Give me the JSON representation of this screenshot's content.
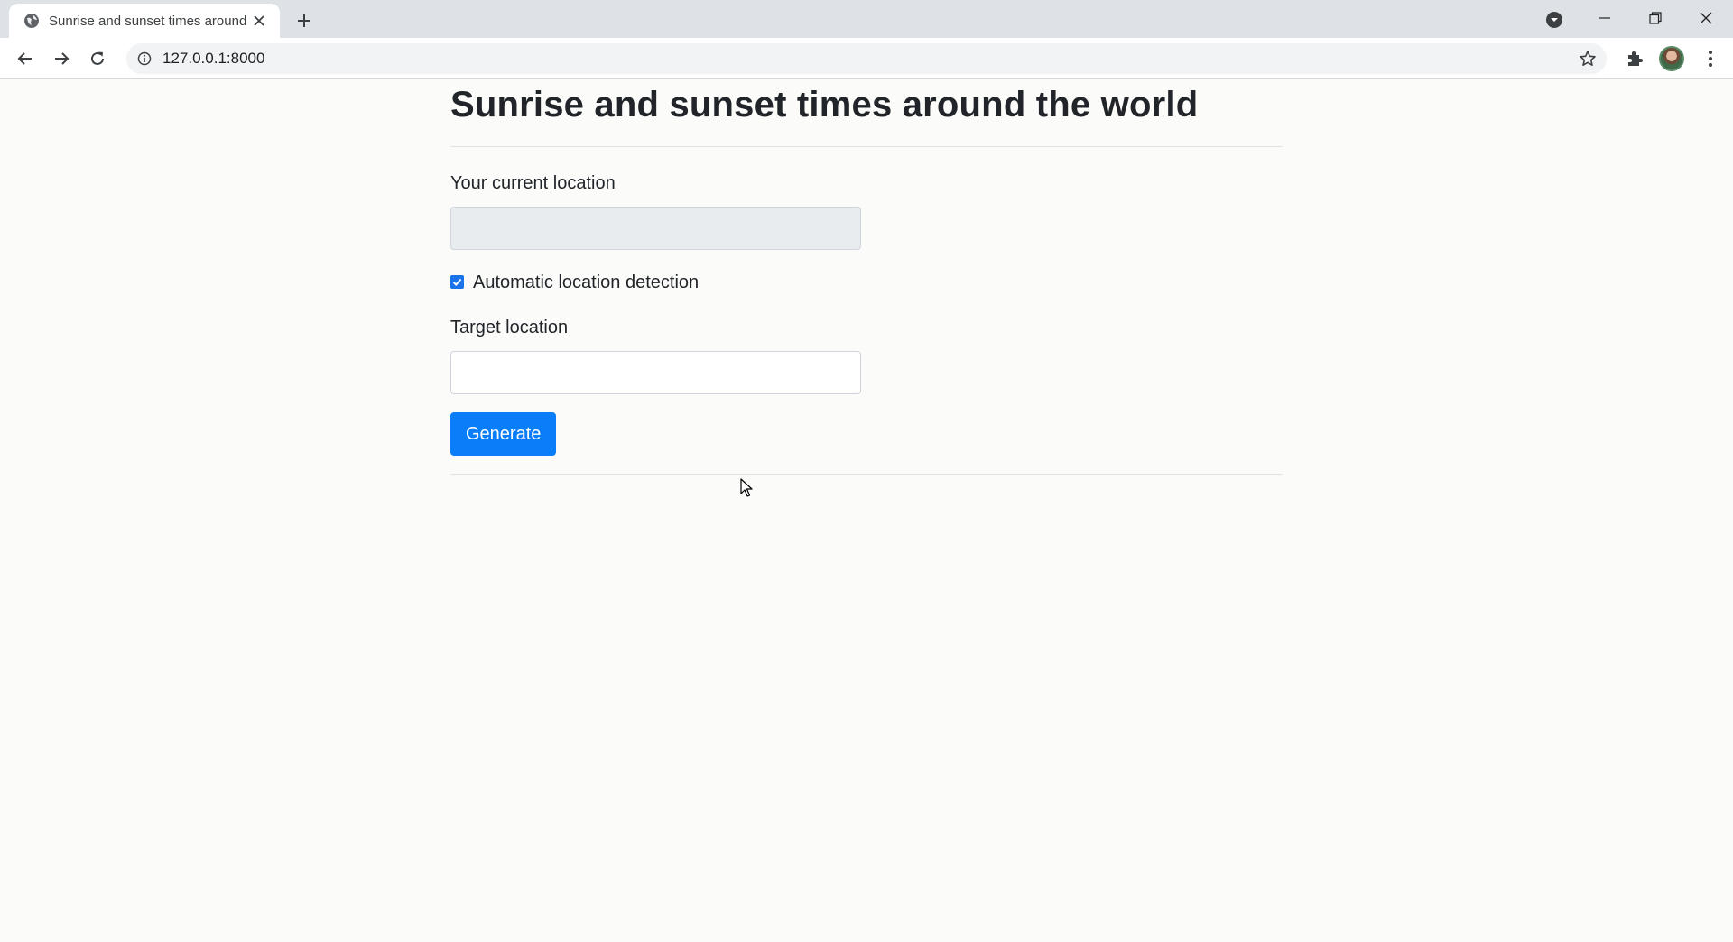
{
  "browser": {
    "tab": {
      "title": "Sunrise and sunset times around",
      "favicon": "globe-icon",
      "close": "close-icon"
    },
    "new_tab": "plus-icon",
    "address": {
      "url": "127.0.0.1:8000",
      "info": "info-icon",
      "bookmark": "star-icon"
    },
    "nav": [
      "back-icon",
      "forward-icon",
      "reload-icon"
    ],
    "toolbar_right": [
      "puzzle-icon",
      "avatar",
      "more-vert-icon"
    ],
    "window_controls": [
      "minimize-icon",
      "restore-icon",
      "close-icon"
    ]
  },
  "page": {
    "title": "Sunrise and sunset times around the world",
    "current_location_label": "Your current location",
    "current_location_value": "",
    "current_location_disabled": true,
    "auto_detect_label": "Automatic location detection",
    "auto_detect_checked": true,
    "target_location_label": "Target location",
    "target_location_value": "",
    "generate_label": "Generate"
  },
  "colors": {
    "accent": "#0a7df8",
    "checkbox": "#1a73e8",
    "page_background": "#fbfbfa",
    "tabstrip": "#dee1e6"
  }
}
